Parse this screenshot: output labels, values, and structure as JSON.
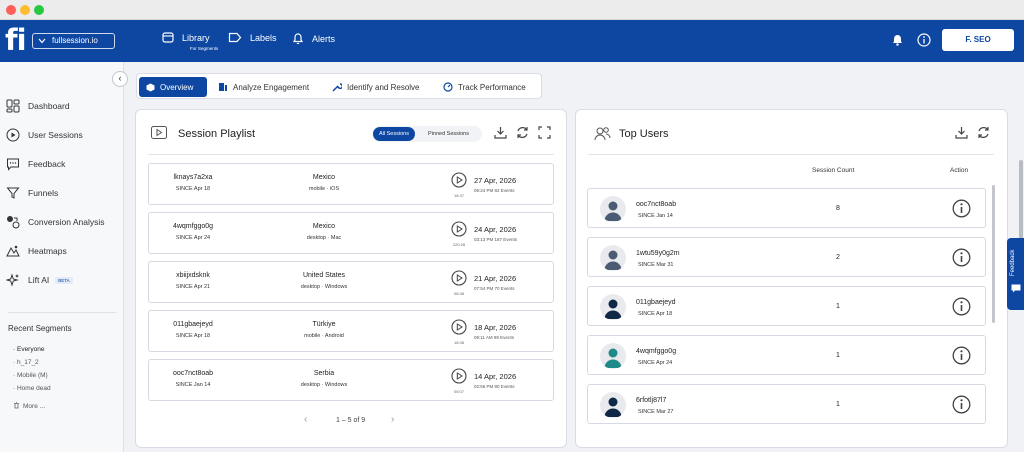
{
  "window": {
    "dots": [
      "#ff5f57",
      "#febc2e",
      "#28c840"
    ]
  },
  "topnav": {
    "logo": "fi",
    "site": "fullsession.io",
    "library": "Library",
    "library_sub": "For Segments",
    "labels": "Labels",
    "alerts": "Alerts",
    "user": "F. SEO"
  },
  "sidebar": {
    "items": [
      {
        "label": "Dashboard",
        "icon": "dashboard-icon"
      },
      {
        "label": "User Sessions",
        "icon": "play-circle-icon"
      },
      {
        "label": "Feedback",
        "icon": "chat-icon"
      },
      {
        "label": "Funnels",
        "icon": "funnel-icon"
      },
      {
        "label": "Conversion Analysis",
        "icon": "conversion-icon"
      },
      {
        "label": "Heatmaps",
        "icon": "heatmap-icon"
      },
      {
        "label": "Lift AI",
        "icon": "sparkle-icon",
        "badge": "BETA"
      }
    ],
    "recent_title": "Recent Segments",
    "segments": [
      "Everyone",
      "h_17_2",
      "Mobile (M)",
      "Home dead"
    ],
    "more": "More ..."
  },
  "tabs": [
    "Overview",
    "Analyze Engagement",
    "Identify and Resolve",
    "Track Performance"
  ],
  "playlist": {
    "title": "Session Playlist",
    "toggle": [
      "All Sessions",
      "Pinned Sessions"
    ],
    "rows": [
      {
        "id": "lknays7a2xa",
        "since": "SINCE Apr 18",
        "country": "Mexico",
        "device": "mobile · iOS",
        "duration": "18:37",
        "date": "27 Apr, 2026",
        "meta": "09:24 PM 82 Events"
      },
      {
        "id": "4wqmfggo0g",
        "since": "SINCE Apr 24",
        "country": "Mexico",
        "device": "desktop · Mac",
        "duration": "220:28",
        "date": "24 Apr, 2026",
        "meta": "03:13 PM 187 Events"
      },
      {
        "id": "xbiijxdsknk",
        "since": "SINCE Apr 21",
        "country": "United States",
        "device": "desktop · Windows",
        "duration": "06:38",
        "date": "21 Apr, 2026",
        "meta": "07:54 PM 70 Events"
      },
      {
        "id": "011gbaejeyd",
        "since": "SINCE Apr 18",
        "country": "Türkiye",
        "device": "mobile · Android",
        "duration": "18:38",
        "date": "18 Apr, 2026",
        "meta": "09:11 AM 99 Events"
      },
      {
        "id": "ooc7nct8oab",
        "since": "SINCE Jan 14",
        "country": "Serbia",
        "device": "desktop · Windows",
        "duration": "05:07",
        "date": "14 Apr, 2026",
        "meta": "02:56 PM 80 Events"
      }
    ],
    "pager": "1 – 5 of 9"
  },
  "top_users": {
    "title": "Top Users",
    "col_count": "Session Count",
    "col_action": "Action",
    "rows": [
      {
        "id": "ooc7nct8oab",
        "since": "SINCE Jan 14",
        "count": "8",
        "avatar_color": "#4a5b73"
      },
      {
        "id": "1wtu59y0g2m",
        "since": "SINCE Mar 31",
        "count": "2",
        "avatar_color": "#4a5b73"
      },
      {
        "id": "011gbaejeyd",
        "since": "SINCE Apr 18",
        "count": "1",
        "avatar_color": "#0f2845"
      },
      {
        "id": "4wqmfggo0g",
        "since": "SINCE Apr 24",
        "count": "1",
        "avatar_color": "#1f8a8a"
      },
      {
        "id": "6rfotlj87l7",
        "since": "SINCE Mar 27",
        "count": "1",
        "avatar_color": "#0f2845"
      }
    ]
  },
  "feedback_tab": "Feedback",
  "colors": {
    "brand": "#0d47a1"
  }
}
